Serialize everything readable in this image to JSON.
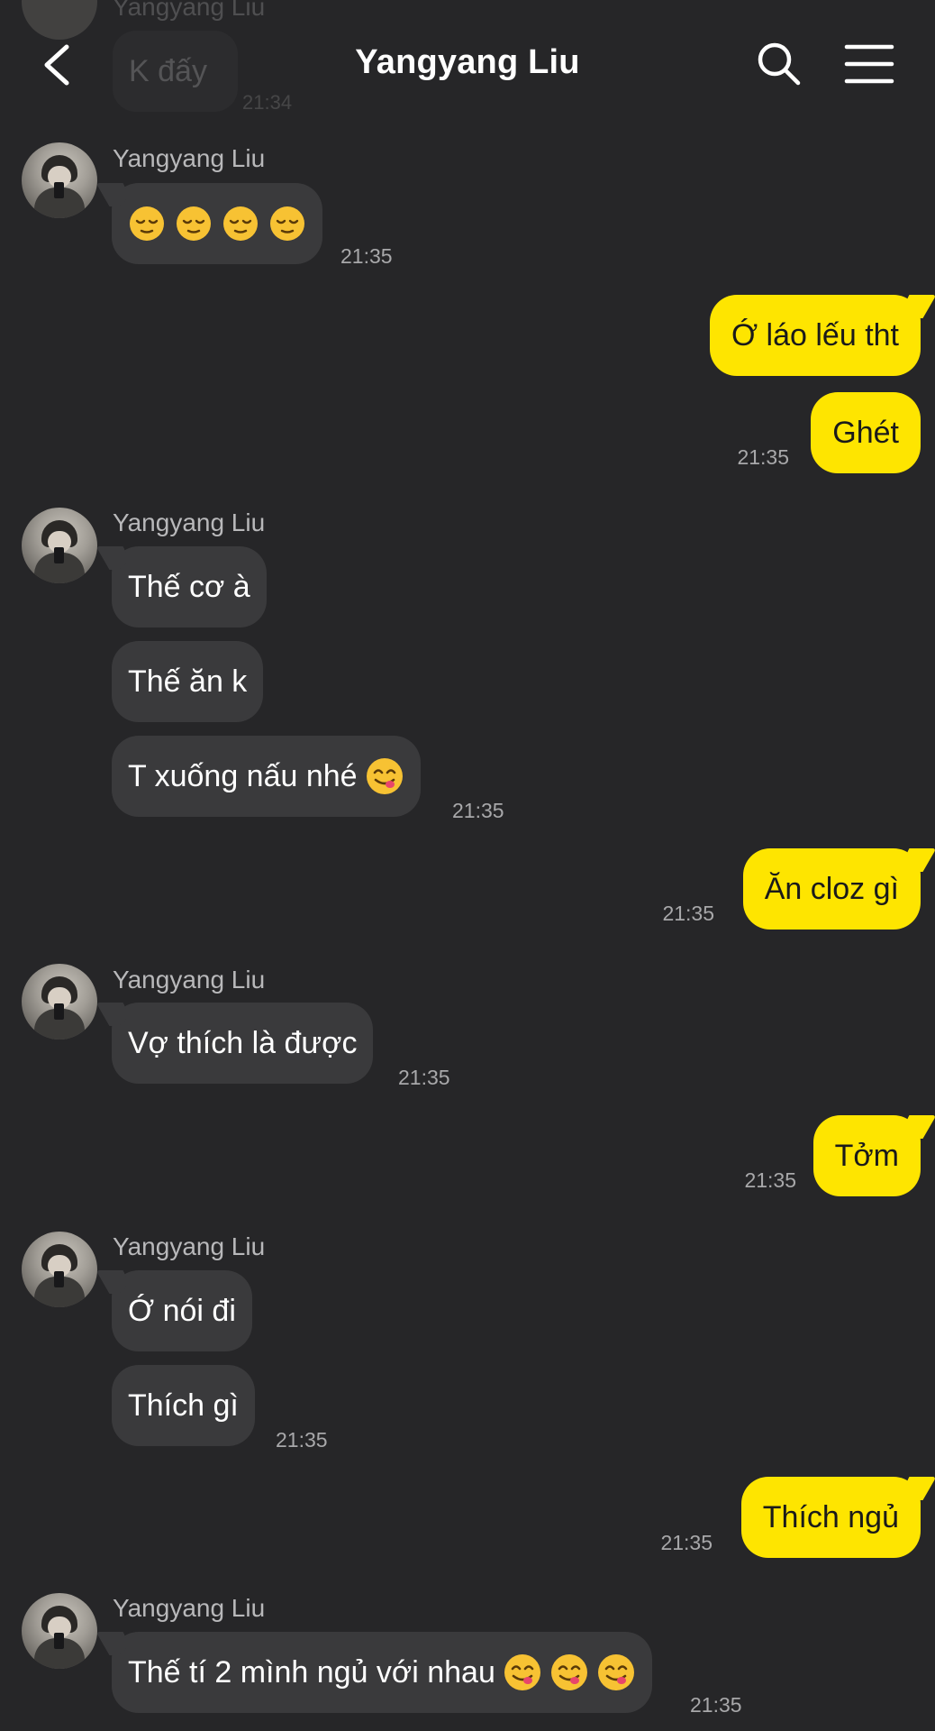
{
  "header": {
    "title": "Yangyang Liu"
  },
  "ghost": {
    "name": "Yangyang Liu",
    "text": "K đấy",
    "time": "21:34"
  },
  "messages": [
    {
      "sender": "Yangyang Liu",
      "text": "",
      "emoji": [
        "relieved-face",
        "relieved-face",
        "relieved-face",
        "relieved-face"
      ],
      "time": "21:35"
    },
    {
      "sender": "me",
      "text": "Ớ láo lếu tht"
    },
    {
      "sender": "me",
      "text": "Ghét",
      "time": "21:35"
    },
    {
      "sender": "Yangyang Liu",
      "text": "Thế cơ à"
    },
    {
      "sender": "Yangyang Liu",
      "text": "Thế ăn k"
    },
    {
      "sender": "Yangyang Liu",
      "text": "T xuống nấu nhé",
      "emoji": [
        "yum-face"
      ],
      "time": "21:35"
    },
    {
      "sender": "me",
      "text": "Ăn cloz gì",
      "time": "21:35"
    },
    {
      "sender": "Yangyang Liu",
      "text": "Vợ thích là được",
      "time": "21:35"
    },
    {
      "sender": "me",
      "text": "Tởm",
      "time": "21:35"
    },
    {
      "sender": "Yangyang Liu",
      "text": "Ớ nói đi"
    },
    {
      "sender": "Yangyang Liu",
      "text": "Thích gì",
      "time": "21:35"
    },
    {
      "sender": "me",
      "text": "Thích ngủ",
      "time": "21:35"
    },
    {
      "sender": "Yangyang Liu",
      "text": "Thế tí 2 mình ngủ với nhau",
      "emoji": [
        "yum-face",
        "yum-face",
        "yum-face"
      ],
      "time": "21:35"
    }
  ],
  "colors": {
    "background": "#262628",
    "incoming_bubble": "#3a3a3c",
    "outgoing_bubble": "#fee500"
  },
  "icons": {
    "back": "chevron-left-icon",
    "search": "search-icon",
    "menu": "hamburger-menu-icon"
  }
}
